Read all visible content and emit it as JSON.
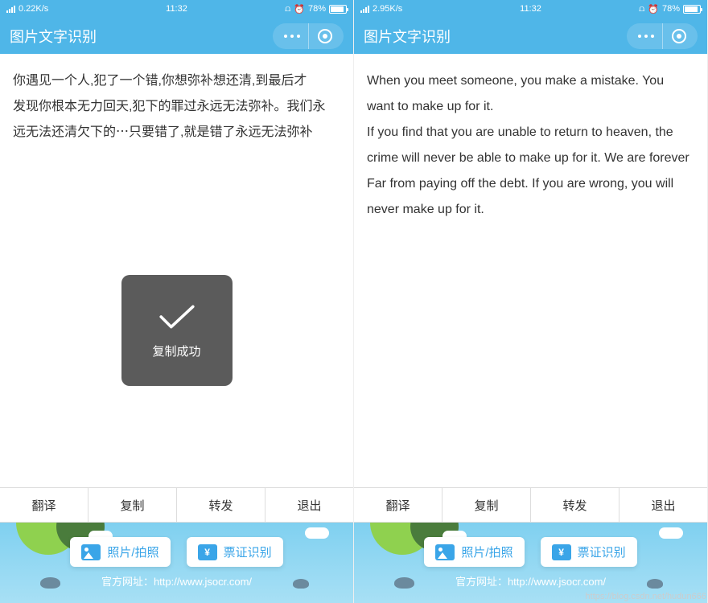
{
  "left": {
    "statusbar": {
      "speed": "0.22K/s",
      "time": "11:32",
      "battery": "78%"
    },
    "title": "图片文字识别",
    "content": "你遇见一个人,犯了一个错,你想弥补想还清,到最后才\n发现你根本无力回天,犯下的罪过永远无法弥补。我们永\n远无法还清欠下的⋯只要错了,就是错了永远无法弥补",
    "toast": "复制成功"
  },
  "right": {
    "statusbar": {
      "speed": "2.95K/s",
      "time": "11:32",
      "battery": "78%"
    },
    "title": "图片文字识别",
    "content": "When you meet someone, you make a mistake. You want to make up for it.\nIf you find that you are unable to return to heaven, the crime will never be able to make up for it. We are forever\nFar from paying off the debt. If you are wrong, you will never make up for it."
  },
  "tabs": [
    "翻译",
    "复制",
    "转发",
    "退出"
  ],
  "footer": {
    "btn1": "照片/拍照",
    "btn2": "票证识别",
    "link_label": "官方网址：",
    "link_url": "http://www.jsocr.com/"
  },
  "watermark": "https://blog.csdn.net/hudun666"
}
